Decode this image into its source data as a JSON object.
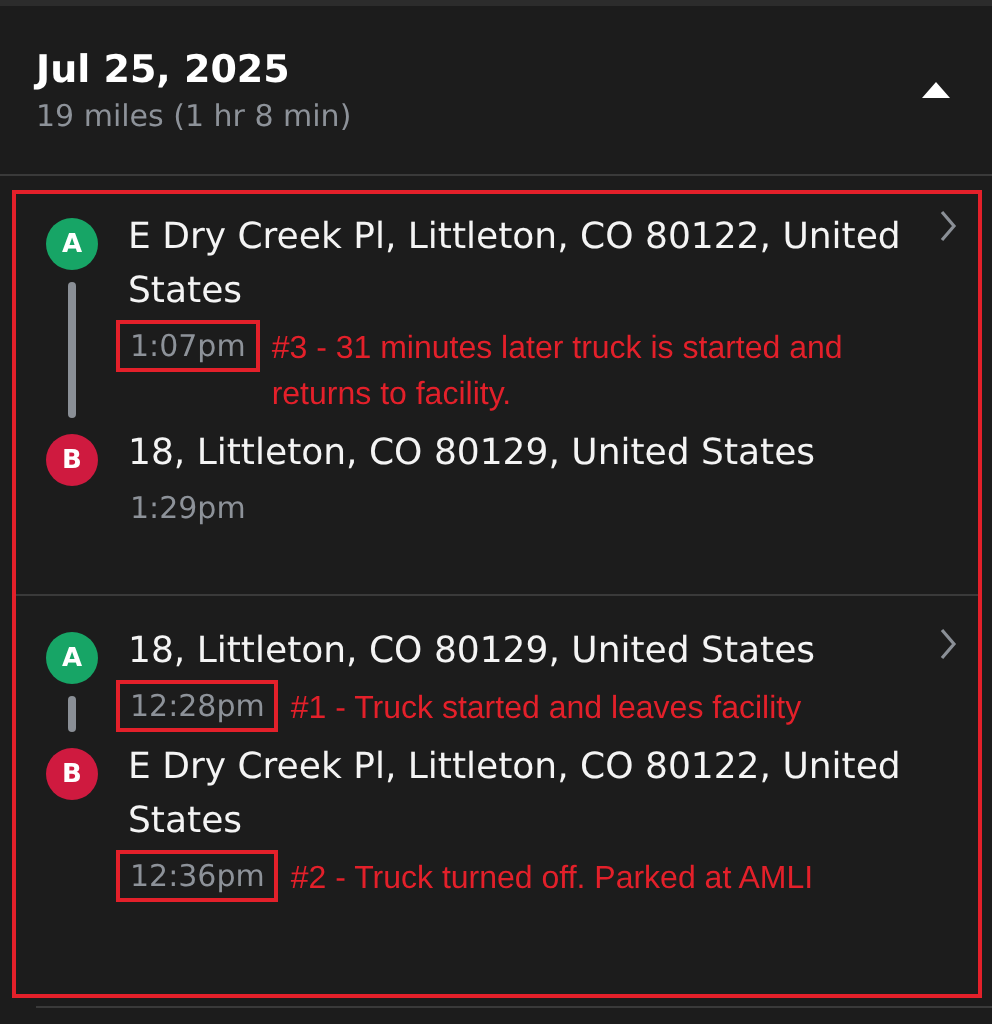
{
  "header": {
    "date": "Jul 25, 2025",
    "summary": "19 miles (1 hr 8 min)",
    "expanded": true
  },
  "trips": [
    {
      "stops": [
        {
          "marker": "A",
          "kind": "start",
          "address": "E Dry Creek Pl, Littleton, CO 80122, United States",
          "time": "1:07pm",
          "time_highlighted": true,
          "annotation": "#3 - 31 minutes later truck is started and returns to facility."
        },
        {
          "marker": "B",
          "kind": "end",
          "address": "18, Littleton, CO 80129, United States",
          "time": "1:29pm",
          "time_highlighted": false
        }
      ]
    },
    {
      "stops": [
        {
          "marker": "A",
          "kind": "start",
          "address": "18, Littleton, CO 80129, United States",
          "time": "12:28pm",
          "time_highlighted": true,
          "annotation": "#1 - Truck started and leaves facility"
        },
        {
          "marker": "B",
          "kind": "end",
          "address": "E Dry Creek Pl, Littleton, CO 80122, United States",
          "time": "12:36pm",
          "time_highlighted": true,
          "annotation": "#2 - Truck turned off. Parked at AMLI"
        }
      ]
    }
  ]
}
